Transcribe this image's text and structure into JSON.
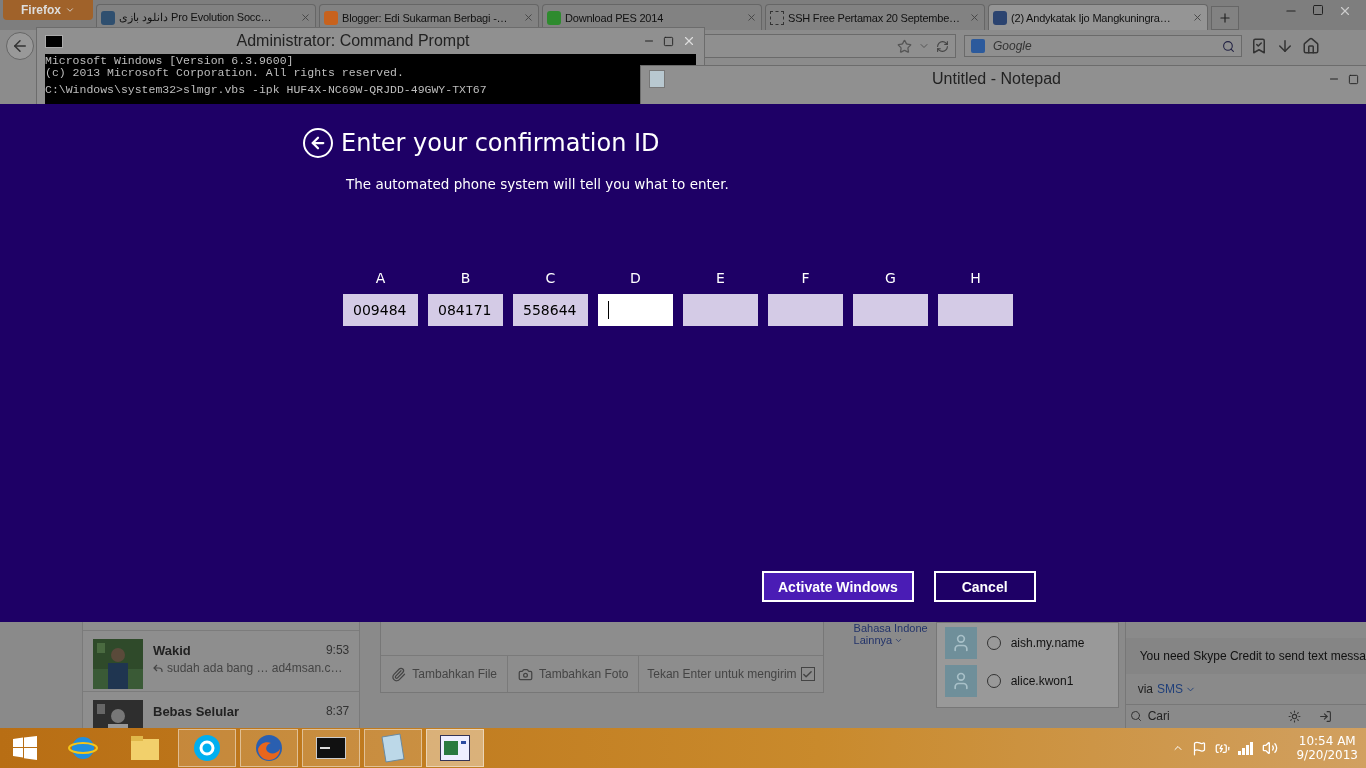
{
  "browser": {
    "menu_button": "Firefox",
    "tabs": [
      {
        "title": "دانلود بازی Pro Evolution Socc…",
        "kind": "page",
        "selected": false
      },
      {
        "title": "Blogger: Edi Sukarman Berbagi -…",
        "kind": "blogger",
        "selected": false
      },
      {
        "title": "Download PES 2014",
        "kind": "green",
        "selected": false
      },
      {
        "title": "SSH Free Pertamax 20 Septembe…",
        "kind": "empty",
        "selected": false
      },
      {
        "title": "(2) Andykatak Ijo Mangkuningra…",
        "kind": "facebook",
        "selected": true
      }
    ],
    "search_placeholder": "Google"
  },
  "command_prompt": {
    "title": "Administrator: Command Prompt",
    "lines": [
      "Microsoft Windows [Version 6.3.9600]",
      "(c) 2013 Microsoft Corporation. All rights reserved.",
      "C:\\Windows\\system32>slmgr.vbs -ipk HUF4X-NC69W-QRJDD-49GWY-TXT67"
    ]
  },
  "notepad": {
    "title": "Untitled - Notepad"
  },
  "dialog": {
    "title": "Enter your confirmation ID",
    "subtitle": "The automated phone system will tell you what to enter.",
    "fields": [
      {
        "label": "A",
        "value": "009484",
        "focused": false
      },
      {
        "label": "B",
        "value": "084171",
        "focused": false
      },
      {
        "label": "C",
        "value": "558644",
        "focused": false
      },
      {
        "label": "D",
        "focused": true
      },
      {
        "label": "E",
        "focused": false
      },
      {
        "label": "F",
        "focused": false
      },
      {
        "label": "G",
        "focused": false
      },
      {
        "label": "H",
        "focused": false
      }
    ],
    "buttons": [
      {
        "label": "Activate Windows",
        "kind": "primary"
      },
      {
        "label": "Cancel",
        "kind": "secondary"
      }
    ]
  },
  "messages": [
    {
      "name": "Wakid",
      "time": "9:53",
      "preview": "sudah ada bang … ad4msan.c…"
    },
    {
      "name": "Bebas Selular",
      "time": "8:37"
    }
  ],
  "composer": {
    "attach_file": "Tambahkan File",
    "attach_photo": "Tambahkan Foto",
    "enter_to_send": "Tekan Enter untuk mengirim",
    "enter_checked": true
  },
  "language": {
    "current": "Bahasa Indone",
    "more": "Lainnya"
  },
  "skype": {
    "contacts": [
      "aish.my.name",
      "alice.kwon1"
    ],
    "notice": "You need Skype Credit to send text messa",
    "via": "via",
    "via_option": "SMS",
    "search_placeholder": "Cari"
  },
  "taskbar": {
    "apps": [
      {
        "kind": "ie",
        "running": false,
        "selected": false
      },
      {
        "kind": "explorer",
        "running": false,
        "selected": false
      },
      {
        "kind": "skype",
        "running": true,
        "selected": false
      },
      {
        "kind": "firefox",
        "running": true,
        "selected": false
      },
      {
        "kind": "cmd",
        "running": true,
        "selected": false
      },
      {
        "kind": "notepad",
        "running": true,
        "selected": false
      },
      {
        "kind": "activation",
        "running": true,
        "selected": true
      }
    ],
    "time": "10:54 AM",
    "date": "9/20/2013"
  }
}
